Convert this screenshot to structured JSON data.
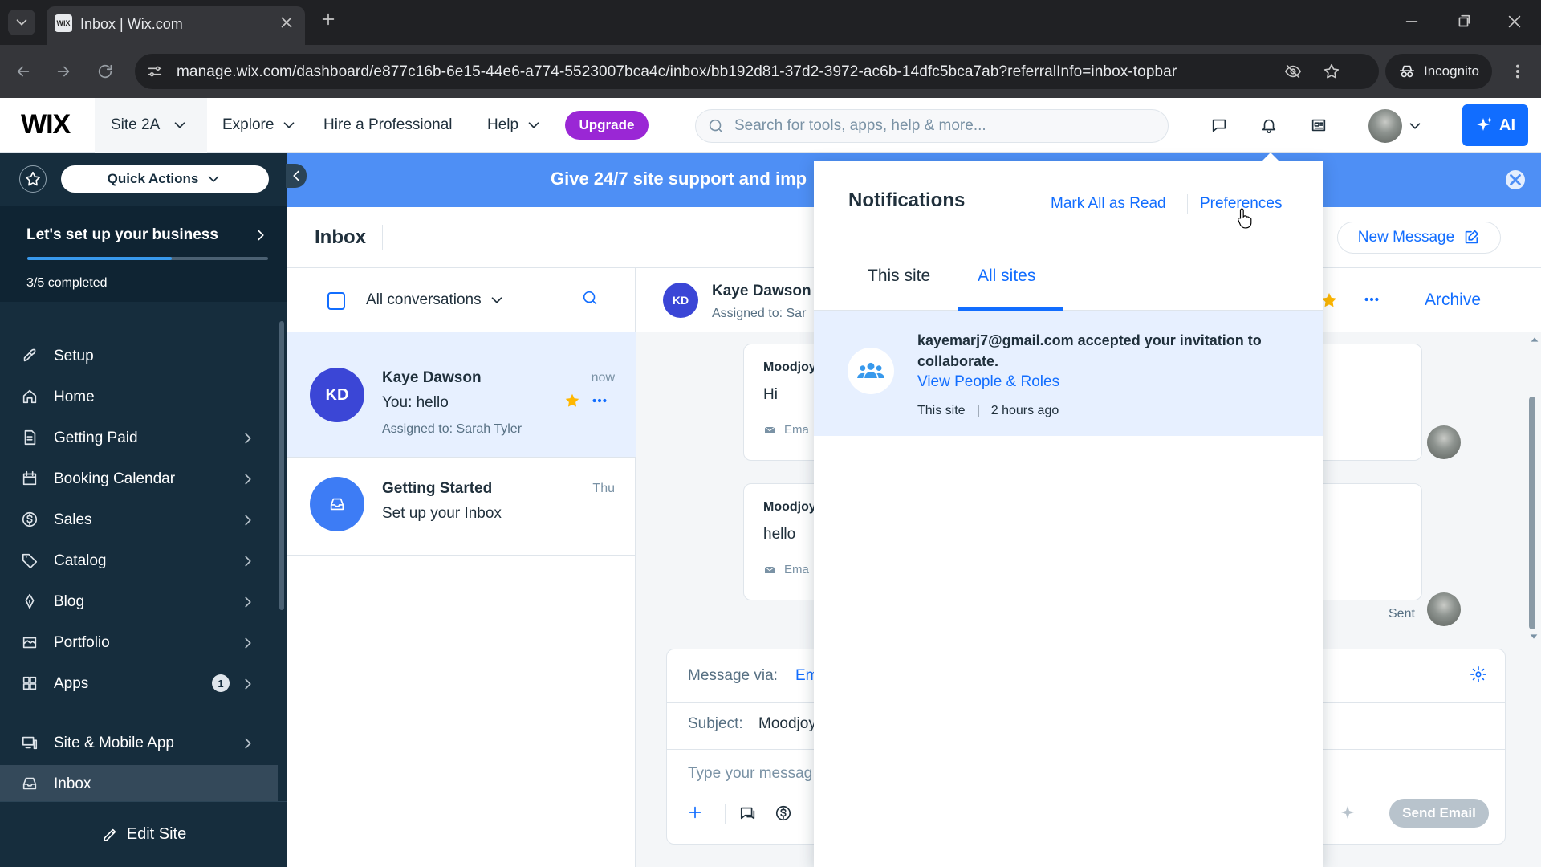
{
  "browser": {
    "tab_title": "Inbox | Wix.com",
    "favicon_text": "WIX",
    "url": "manage.wix.com/dashboard/e877c16b-6e15-44e6-a774-5523007bca4c/inbox/bb192d81-37d2-3972-ac6b-14dfc5bca7ab?referralInfo=inbox-topbar",
    "incognito_label": "Incognito"
  },
  "topbar": {
    "logo": "WIX",
    "site_name": "Site 2A",
    "explore": "Explore",
    "hire": "Hire a Professional",
    "help": "Help",
    "upgrade": "Upgrade",
    "search_placeholder": "Search for tools, apps, help & more...",
    "ai_label": "AI"
  },
  "sidebar": {
    "quick_actions": "Quick Actions",
    "setup_title": "Let's set up your business",
    "setup_count": "3/5 completed",
    "setup_progress": 0.6,
    "items": [
      {
        "label": "Setup"
      },
      {
        "label": "Home"
      },
      {
        "label": "Getting Paid"
      },
      {
        "label": "Booking Calendar"
      },
      {
        "label": "Sales"
      },
      {
        "label": "Catalog"
      },
      {
        "label": "Blog"
      },
      {
        "label": "Portfolio"
      },
      {
        "label": "Apps",
        "badge": "1"
      },
      {
        "label": "Site & Mobile App"
      },
      {
        "label": "Inbox"
      }
    ],
    "edit_site": "Edit Site"
  },
  "banner": {
    "text": "Give 24/7 site support and imp"
  },
  "inbox": {
    "title": "Inbox",
    "new_message": "New Message",
    "filter": "All conversations",
    "conversations": [
      {
        "initials": "KD",
        "name": "Kaye Dawson",
        "preview": "You: hello",
        "assigned": "Assigned to: Sarah Tyler",
        "time": "now"
      },
      {
        "name": "Getting Started",
        "preview": "Set up your Inbox",
        "time": "Thu"
      }
    ]
  },
  "chat": {
    "initials": "KD",
    "name": "Kaye Dawson",
    "assigned": "Assigned to: Sar",
    "archive": "Archive",
    "messages": [
      {
        "from": "Moodjoy",
        "body": "Hi",
        "via": "Ema"
      },
      {
        "from": "Moodjoy",
        "body": "hello",
        "via": "Ema"
      }
    ],
    "sent_label": "Sent",
    "composer": {
      "via_label": "Message via:",
      "via_value": "Em",
      "subject_label": "Subject:",
      "subject_value": "Moodjoy",
      "placeholder": "Type your messag",
      "send": "Send Email"
    }
  },
  "notifications": {
    "title": "Notifications",
    "mark_all": "Mark All as Read",
    "preferences": "Preferences",
    "tabs": [
      "This site",
      "All sites"
    ],
    "item": {
      "text": "kayemarj7@gmail.com accepted your invitation to collaborate.",
      "link": "View People & Roles",
      "scope": "This site",
      "separator": "|",
      "time": "2 hours ago"
    }
  },
  "colors": {
    "accent": "#116dff",
    "sidebar": "#162d3d",
    "upgrade": "#9a27d5",
    "banner": "#4e8ff5",
    "star": "#ffb700"
  }
}
